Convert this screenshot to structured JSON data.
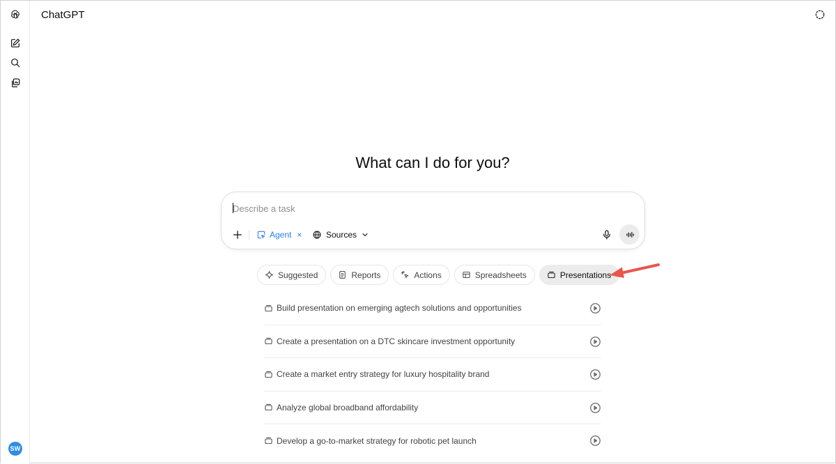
{
  "app": {
    "title": "ChatGPT",
    "user_initials": "SW"
  },
  "sidebar": {
    "items": [
      {
        "icon": "openai-logo-icon"
      },
      {
        "icon": "new-chat-icon"
      },
      {
        "icon": "search-icon"
      },
      {
        "icon": "library-icon"
      }
    ]
  },
  "main": {
    "heading": "What can I do for you?",
    "composer": {
      "placeholder": "Describe a task",
      "value": "",
      "agent_label": "Agent",
      "agent_close": "×",
      "sources_label": "Sources"
    },
    "tabs": [
      {
        "label": "Suggested",
        "icon": "sparkle-icon",
        "active": false
      },
      {
        "label": "Reports",
        "icon": "document-icon",
        "active": false
      },
      {
        "label": "Actions",
        "icon": "cursor-click-icon",
        "active": false
      },
      {
        "label": "Spreadsheets",
        "icon": "spreadsheet-icon",
        "active": false
      },
      {
        "label": "Presentations",
        "icon": "presentation-icon",
        "active": true
      }
    ],
    "suggestions": [
      {
        "text": "Build presentation on emerging agtech solutions and opportunities"
      },
      {
        "text": "Create a presentation on a DTC skincare investment opportunity"
      },
      {
        "text": "Create a market entry strategy for luxury hospitality brand"
      },
      {
        "text": "Analyze global broadband affordability"
      },
      {
        "text": "Develop a go-to-market strategy for robotic pet launch"
      }
    ]
  },
  "colors": {
    "accent": "#2b7de9",
    "avatar": "#2f8de4",
    "annotation_arrow": "#e8574a"
  }
}
